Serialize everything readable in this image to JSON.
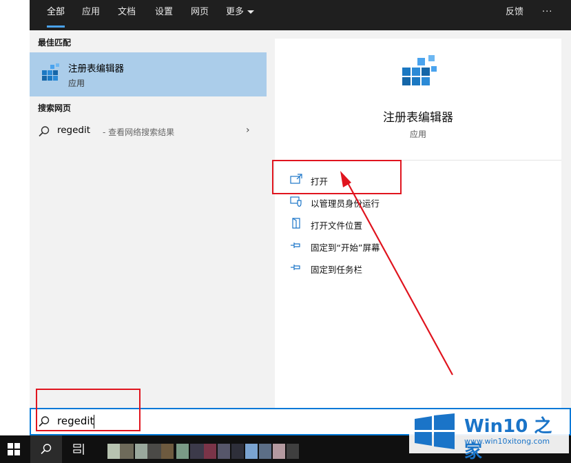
{
  "tabs": [
    {
      "label": "全部",
      "active": true
    },
    {
      "label": "应用"
    },
    {
      "label": "文档"
    },
    {
      "label": "设置"
    },
    {
      "label": "网页"
    },
    {
      "label": "更多"
    }
  ],
  "topbar_right": {
    "feedback": "反馈",
    "more": "···"
  },
  "best_match": {
    "header": "最佳匹配",
    "title": "注册表编辑器",
    "subtitle": "应用",
    "icon": "registry-editor-icon"
  },
  "web_search": {
    "header": "搜索网页",
    "term": "regedit",
    "desc": "- 查看网络搜索结果",
    "chevron": "›"
  },
  "detail": {
    "title": "注册表编辑器",
    "subtitle": "应用",
    "actions": [
      {
        "label": "打开",
        "icon": "open-icon"
      },
      {
        "label": "以管理员身份运行",
        "icon": "shield-icon"
      },
      {
        "label": "打开文件位置",
        "icon": "folder-icon"
      },
      {
        "label": "固定到“开始”屏幕",
        "icon": "pin-icon"
      },
      {
        "label": "固定到任务栏",
        "icon": "pin-icon"
      }
    ]
  },
  "search": {
    "value": "regedit",
    "icon": "search-icon"
  },
  "watermark": {
    "title": "Win10 之家",
    "url": "www.win10xitong.com"
  },
  "colors": {
    "accent": "#0078d7",
    "selected": "#abcdea",
    "annotation": "#e0141e",
    "topbar": "#1f1f1f"
  }
}
